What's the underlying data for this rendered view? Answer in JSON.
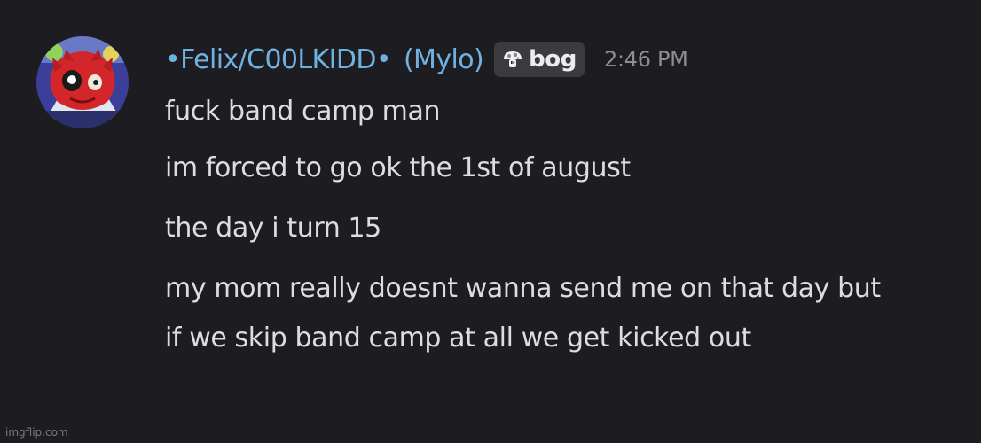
{
  "message": {
    "author": {
      "display_name": "•Felix/C00LKIDD•",
      "nickname": "(Mylo)",
      "tag": {
        "icon": "mushroom-icon",
        "label": "bog"
      },
      "accent_color": "#6fb2e2"
    },
    "timestamp": "2:46 PM",
    "lines": [
      "fuck band camp man",
      "im forced to go ok the 1st of august",
      "the day i turn 15",
      "my mom really doesnt wanna send me on that day but if we skip band camp at all we get kicked out"
    ]
  },
  "watermark": "imgflip.com"
}
